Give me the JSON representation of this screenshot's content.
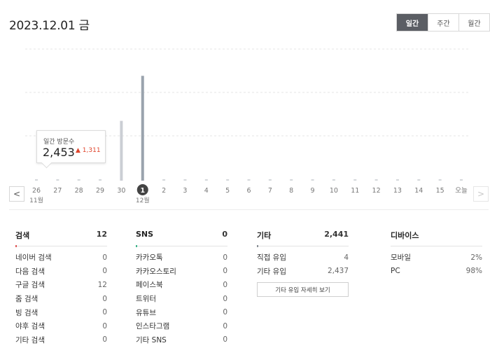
{
  "header": {
    "date": "2023.12.01 금"
  },
  "period_tabs": [
    {
      "label": "일간",
      "active": true
    },
    {
      "label": "주간",
      "active": false
    },
    {
      "label": "월간",
      "active": false
    }
  ],
  "tooltip": {
    "label": "일간 방문수",
    "value": "2,453",
    "diff": "▲ 1,311"
  },
  "chart_data": {
    "type": "bar",
    "categories": [
      "26",
      "27",
      "28",
      "29",
      "30",
      "1",
      "2",
      "3",
      "4",
      "5",
      "6",
      "7",
      "8",
      "9",
      "10",
      "11",
      "12",
      "13",
      "14",
      "15",
      "오늘"
    ],
    "month_labels": [
      {
        "at": "26",
        "label": "11월"
      },
      {
        "at": "1",
        "label": "12월"
      }
    ],
    "selected": "1",
    "series": [
      {
        "values": [
          30,
          0,
          0,
          20,
          2453,
          4300,
          0,
          15,
          50,
          0,
          0,
          15,
          0,
          0,
          0,
          20,
          0,
          0,
          20,
          20,
          30
        ]
      }
    ],
    "ylim": [
      0,
      5400
    ],
    "grid": true,
    "colors": {
      "bar": "#9aa3ad",
      "bar_prev": "#cbced4",
      "selected_badge": "#444444",
      "grid": "#e6e6e6"
    }
  },
  "panels": [
    {
      "title": "검색",
      "total": "12",
      "accent": "#e05a5a",
      "rows": [
        {
          "label": "네이버 검색",
          "value": "0"
        },
        {
          "label": "다음 검색",
          "value": "0"
        },
        {
          "label": "구글 검색",
          "value": "12"
        },
        {
          "label": "줌 검색",
          "value": "0"
        },
        {
          "label": "빙 검색",
          "value": "0"
        },
        {
          "label": "야후 검색",
          "value": "0"
        },
        {
          "label": "기타 검색",
          "value": "0"
        }
      ]
    },
    {
      "title": "SNS",
      "total": "0",
      "accent": "#3fb58c",
      "rows": [
        {
          "label": "카카오톡",
          "value": "0"
        },
        {
          "label": "카카오스토리",
          "value": "0"
        },
        {
          "label": "페이스북",
          "value": "0"
        },
        {
          "label": "트위터",
          "value": "0"
        },
        {
          "label": "유튜브",
          "value": "0"
        },
        {
          "label": "인스타그램",
          "value": "0"
        },
        {
          "label": "기타 SNS",
          "value": "0"
        }
      ]
    },
    {
      "title": "기타",
      "total": "2,441",
      "accent": "#8a8f96",
      "rows": [
        {
          "label": "직접 유입",
          "value": "4"
        },
        {
          "label": "기타 유입",
          "value": "2,437"
        }
      ],
      "button": "기타 유입 자세히 보기"
    },
    {
      "title": "디바이스",
      "total": "",
      "accent": "",
      "rows": [
        {
          "label": "모바일",
          "value": "2%"
        },
        {
          "label": "PC",
          "value": "98%"
        }
      ]
    }
  ]
}
